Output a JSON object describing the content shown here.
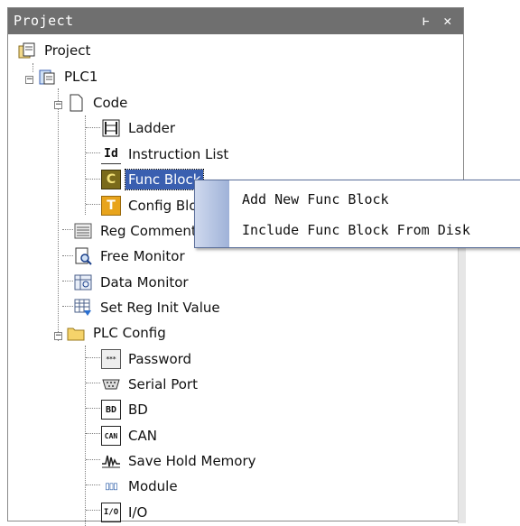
{
  "panel": {
    "title": "Project",
    "pin_glyph": "ⱶ",
    "close_glyph": "✕"
  },
  "tree": {
    "root": "Project",
    "plc": "PLC1",
    "code": "Code",
    "ladder": "Ladder",
    "instruction_list": "Instruction List",
    "func_block": "Func Block",
    "config_block": "Config Block",
    "reg_comment": "Reg Comment",
    "free_monitor": "Free Monitor",
    "data_monitor": "Data Monitor",
    "set_reg_init": "Set Reg Init Value",
    "plc_config": "PLC Config",
    "password": "Password",
    "serial_port": "Serial Port",
    "bd": "BD",
    "can": "CAN",
    "save_hold_memory": "Save Hold Memory",
    "module": "Module",
    "io": "I/O"
  },
  "icons": {
    "id_text": "Id",
    "func_letter": "C",
    "config_letter": "T",
    "bd_text": "BD",
    "can_text": "CAN",
    "io_text": "I/O",
    "module_text": "▯▯▯"
  },
  "context_menu": {
    "items": [
      "Add New Func Block",
      "Include Func Block From Disk"
    ]
  },
  "colors": {
    "titlebar": "#6f6f6f",
    "selection": "#3a5fb0",
    "menu_strip": "#9fb2d8"
  }
}
